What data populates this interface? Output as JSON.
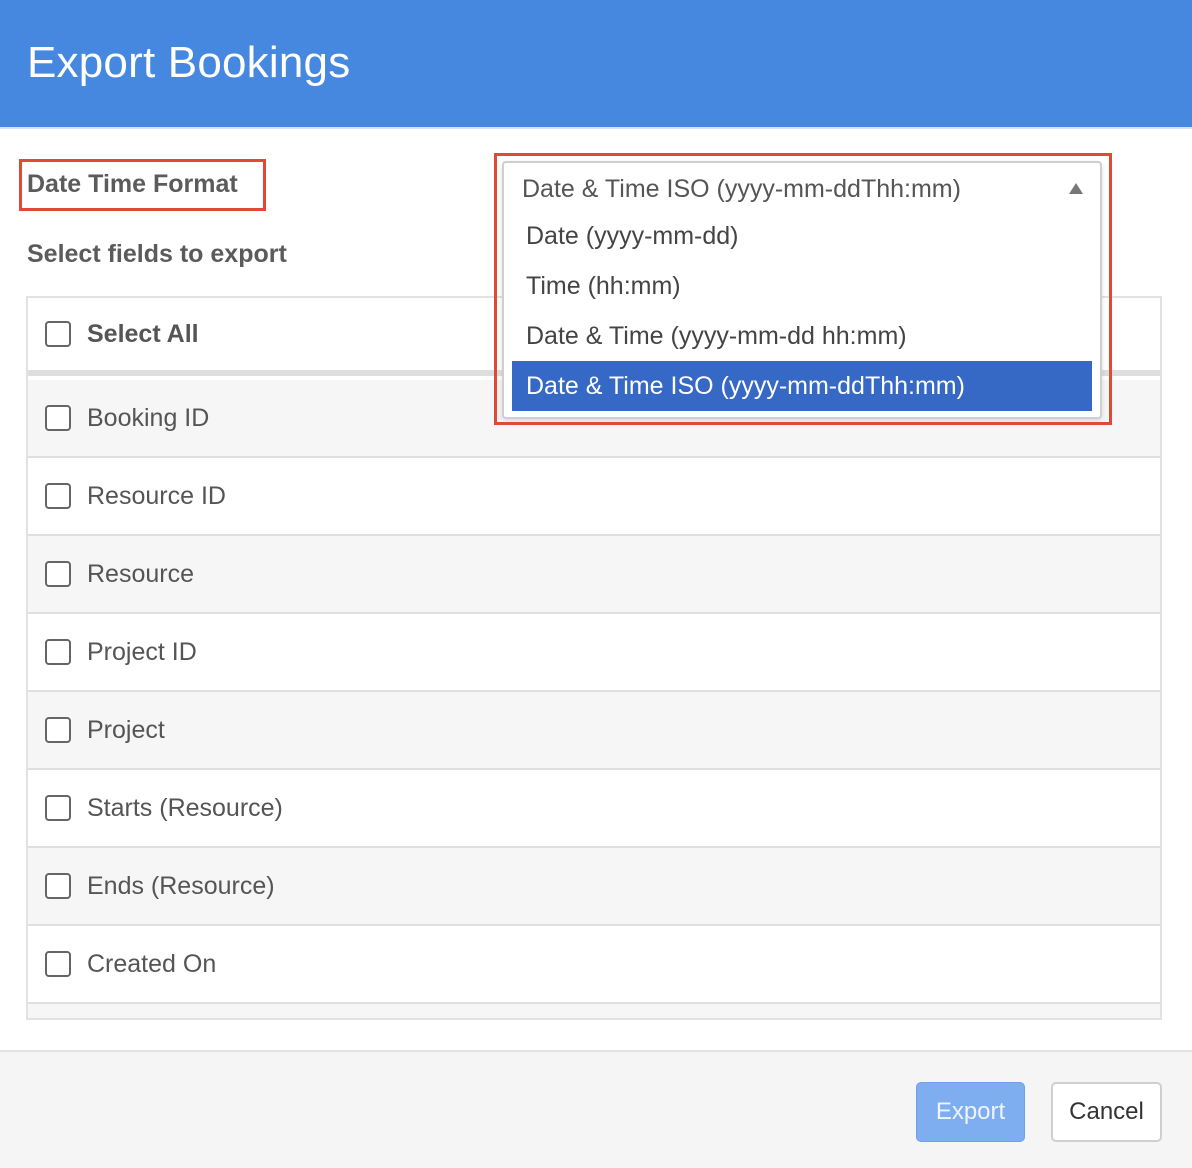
{
  "dialog": {
    "title": "Export Bookings"
  },
  "date_time_format": {
    "label": "Date Time Format",
    "current": "Date & Time ISO (yyyy-mm-ddThh:mm)",
    "options": [
      "Date (yyyy-mm-dd)",
      "Time (hh:mm)",
      "Date & Time (yyyy-mm-dd hh:mm)",
      "Date & Time ISO (yyyy-mm-ddThh:mm)"
    ],
    "selected_index": 3
  },
  "fields": {
    "label": "Select fields to export",
    "select_all": "Select All",
    "items": [
      "Booking ID",
      "Resource ID",
      "Resource",
      "Project ID",
      "Project",
      "Starts (Resource)",
      "Ends (Resource)",
      "Created On"
    ]
  },
  "footer": {
    "export_label": "Export",
    "cancel_label": "Cancel"
  },
  "colors": {
    "header": "#4688df",
    "highlight_border": "#e04a35",
    "selected_option": "#3668c5",
    "export_button": "#7eaef0"
  }
}
